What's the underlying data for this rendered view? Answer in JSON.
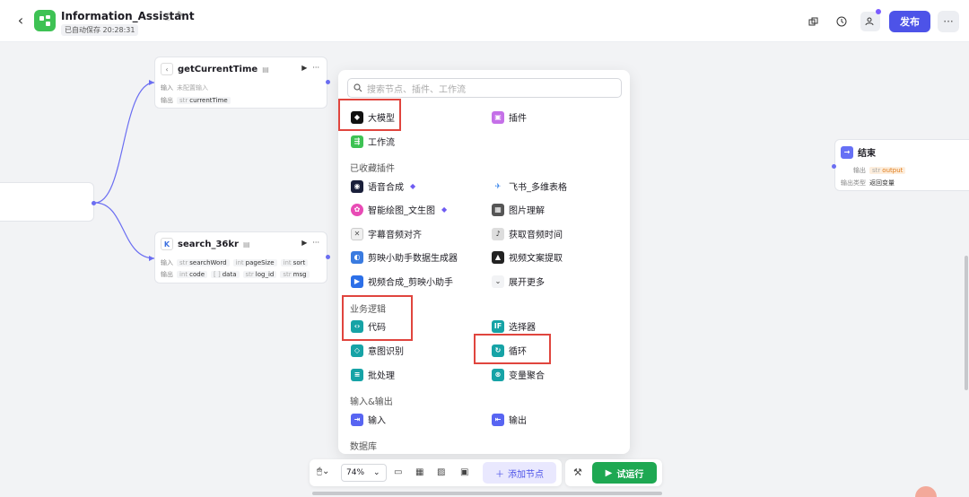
{
  "header": {
    "app_title": "Information_Assistant",
    "autosave": "已自动保存 20:28:31",
    "publish_label": "发布"
  },
  "nodes": {
    "get_time": {
      "title": "getCurrentTime",
      "input_label": "输入",
      "input_value": "未配置输入",
      "output_label": "输出",
      "output_type": "str",
      "output_value": "currentTime"
    },
    "search": {
      "title": "search_36kr",
      "input_label": "输入",
      "output_label": "输出",
      "inputs": [
        {
          "type": "str",
          "name": "searchWord"
        },
        {
          "type": "int",
          "name": "pageSize"
        },
        {
          "type": "int",
          "name": "sort"
        }
      ],
      "outputs": [
        {
          "type": "int",
          "name": "code"
        },
        {
          "type": "[ ]",
          "name": "data"
        },
        {
          "type": "str",
          "name": "log_id"
        },
        {
          "type": "str",
          "name": "msg"
        }
      ]
    },
    "end": {
      "title": "结束",
      "output_label": "输出",
      "output_type": "str",
      "output_value": "output",
      "output_kind_label": "输出类型",
      "output_kind_value": "返回变量"
    }
  },
  "panel": {
    "search_placeholder": "搜索节点、插件、工作流",
    "top_items": {
      "llm": "大模型",
      "plugin": "插件",
      "workflow": "工作流"
    },
    "favorites_title": "已收藏插件",
    "favorites": {
      "tts": "语音合成",
      "feishu": "飞书_多维表格",
      "draw": "智能绘图_文生图",
      "image": "图片理解",
      "subtitle": "字幕音频对齐",
      "audio_time": "获取音频时间",
      "jianying_data": "剪映小助手数据生成器",
      "video_copy": "视频文案提取",
      "video_merge": "视频合成_剪映小助手",
      "expand": "展开更多"
    },
    "logic_title": "业务逻辑",
    "logic": {
      "code": "代码",
      "selector": "选择器",
      "intent": "意图识别",
      "loop": "循环",
      "batch": "批处理",
      "var_merge": "变量聚合"
    },
    "io_title": "输入&输出",
    "io": {
      "input": "输入",
      "output": "输出"
    },
    "db_title": "数据库"
  },
  "bottom": {
    "zoom": "74%",
    "add_node": "添加节点",
    "run": "试运行"
  },
  "colors": {
    "accent": "#4d53e8",
    "run": "#1ea852",
    "highlight": "#e0453e",
    "edge": "#6b6ef2"
  }
}
